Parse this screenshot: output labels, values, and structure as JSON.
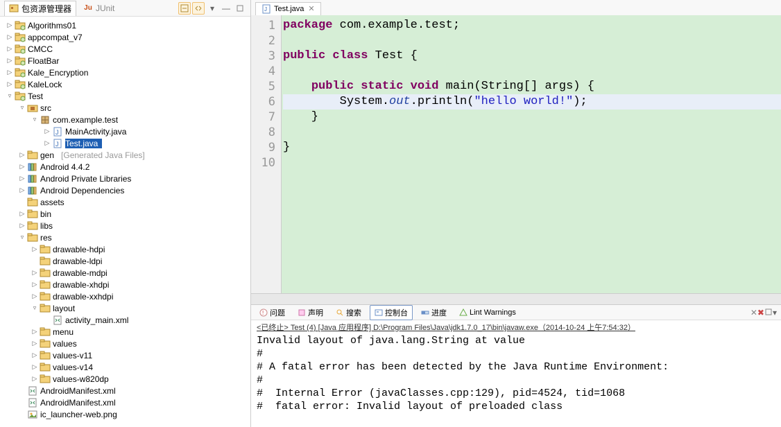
{
  "leftPane": {
    "tabs": [
      {
        "label": "包资源管理器",
        "active": true
      },
      {
        "label": "JUnit",
        "active": false
      }
    ],
    "toolbarIcons": [
      "collapse-all",
      "link-editor",
      "view-menu",
      "minimize",
      "maximize"
    ]
  },
  "tree": [
    {
      "depth": 0,
      "arrow": "▷",
      "icon": "project",
      "label": "Algorithms01"
    },
    {
      "depth": 0,
      "arrow": "▷",
      "icon": "project",
      "label": "appcompat_v7"
    },
    {
      "depth": 0,
      "arrow": "▷",
      "icon": "project",
      "label": "CMCC"
    },
    {
      "depth": 0,
      "arrow": "▷",
      "icon": "project",
      "label": "FloatBar"
    },
    {
      "depth": 0,
      "arrow": "▷",
      "icon": "project",
      "label": "Kale_Encryption"
    },
    {
      "depth": 0,
      "arrow": "▷",
      "icon": "project",
      "label": "KaleLock"
    },
    {
      "depth": 0,
      "arrow": "▿",
      "icon": "project",
      "label": "Test"
    },
    {
      "depth": 1,
      "arrow": "▿",
      "icon": "package-folder",
      "label": "src"
    },
    {
      "depth": 2,
      "arrow": "▿",
      "icon": "package",
      "label": "com.example.test"
    },
    {
      "depth": 3,
      "arrow": "▷",
      "icon": "java-file",
      "label": "MainActivity.java"
    },
    {
      "depth": 3,
      "arrow": "▷",
      "icon": "java-file",
      "label": "Test.java",
      "selected": true
    },
    {
      "depth": 1,
      "arrow": "▷",
      "icon": "folder-gen",
      "label": "gen",
      "extra": "[Generated Java Files]"
    },
    {
      "depth": 1,
      "arrow": "▷",
      "icon": "library",
      "label": "Android 4.4.2"
    },
    {
      "depth": 1,
      "arrow": "▷",
      "icon": "library",
      "label": "Android Private Libraries"
    },
    {
      "depth": 1,
      "arrow": "▷",
      "icon": "library",
      "label": "Android Dependencies"
    },
    {
      "depth": 1,
      "arrow": "",
      "icon": "folder",
      "label": "assets"
    },
    {
      "depth": 1,
      "arrow": "▷",
      "icon": "folder",
      "label": "bin"
    },
    {
      "depth": 1,
      "arrow": "▷",
      "icon": "folder",
      "label": "libs"
    },
    {
      "depth": 1,
      "arrow": "▿",
      "icon": "folder",
      "label": "res"
    },
    {
      "depth": 2,
      "arrow": "▷",
      "icon": "folder",
      "label": "drawable-hdpi"
    },
    {
      "depth": 2,
      "arrow": "",
      "icon": "folder",
      "label": "drawable-ldpi"
    },
    {
      "depth": 2,
      "arrow": "▷",
      "icon": "folder",
      "label": "drawable-mdpi"
    },
    {
      "depth": 2,
      "arrow": "▷",
      "icon": "folder",
      "label": "drawable-xhdpi"
    },
    {
      "depth": 2,
      "arrow": "▷",
      "icon": "folder",
      "label": "drawable-xxhdpi"
    },
    {
      "depth": 2,
      "arrow": "▿",
      "icon": "folder",
      "label": "layout"
    },
    {
      "depth": 3,
      "arrow": "",
      "icon": "xml-file",
      "label": "activity_main.xml"
    },
    {
      "depth": 2,
      "arrow": "▷",
      "icon": "folder",
      "label": "menu"
    },
    {
      "depth": 2,
      "arrow": "▷",
      "icon": "folder",
      "label": "values"
    },
    {
      "depth": 2,
      "arrow": "▷",
      "icon": "folder",
      "label": "values-v11"
    },
    {
      "depth": 2,
      "arrow": "▷",
      "icon": "folder",
      "label": "values-v14"
    },
    {
      "depth": 2,
      "arrow": "▷",
      "icon": "folder",
      "label": "values-w820dp"
    },
    {
      "depth": 1,
      "arrow": "",
      "icon": "xml-file",
      "label": "AndroidManifest.xml"
    },
    {
      "depth": 1,
      "arrow": "",
      "icon": "xml-file",
      "label": "AndroidManifest.xml"
    },
    {
      "depth": 1,
      "arrow": "",
      "icon": "image-file",
      "label": "ic_launcher-web.png"
    }
  ],
  "editor": {
    "tabLabel": "Test.java",
    "lineCount": 10,
    "code": {
      "l1": {
        "pkg": "package",
        "rest": " com.example.test;"
      },
      "l3a": "public class",
      "l3b": " Test {",
      "l5a": "public static void",
      "l5b": " main(String[] args) {",
      "l6a": "        System.",
      "l6out": "out",
      "l6b": ".println(",
      "l6str": "\"hello world!\"",
      "l6c": ");",
      "l7": "    }",
      "l9": "}"
    }
  },
  "bottomTabs": [
    {
      "label": "问题",
      "icon": "problems-icon"
    },
    {
      "label": "声明",
      "icon": "decl-icon"
    },
    {
      "label": "搜索",
      "icon": "search-icon"
    },
    {
      "label": "控制台",
      "icon": "console-icon",
      "active": true
    },
    {
      "label": "进度",
      "icon": "progress-icon"
    },
    {
      "label": "Lint Warnings",
      "icon": "lint-icon"
    }
  ],
  "console": {
    "header": "<已终止> Test (4) [Java 应用程序] D:\\Program Files\\Java\\jdk1.7.0_17\\bin\\javaw.exe（2014-10-24 上午7:54:32）",
    "lines": [
      "Invalid layout of java.lang.String at value",
      "#",
      "# A fatal error has been detected by the Java Runtime Environment:",
      "#",
      "#  Internal Error (javaClasses.cpp:129), pid=4524, tid=1068",
      "#  fatal error: Invalid layout of preloaded class"
    ]
  }
}
